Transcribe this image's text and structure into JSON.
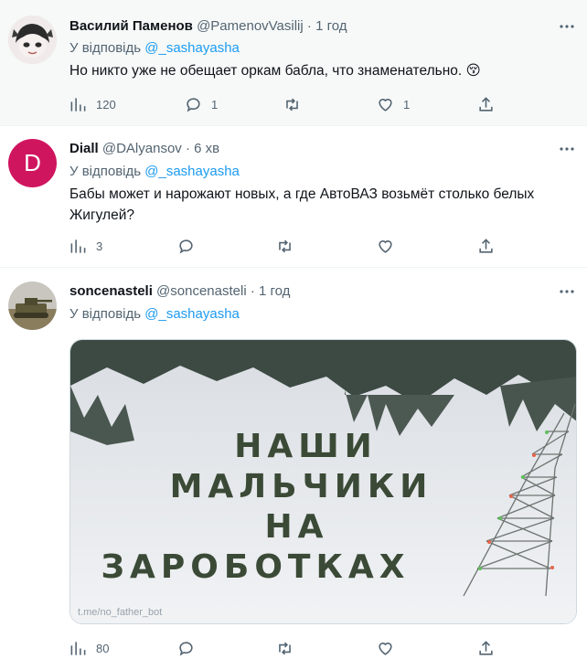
{
  "tweets": [
    {
      "name": "Василий Паменов",
      "handle": "@PamenovVasilij",
      "sep": "·",
      "time": "1 год",
      "reply_prefix": "У відповідь",
      "reply_to": "@_sashayasha",
      "text": "Но никто уже не обещает оркам бабла, что знаменательно. 😚",
      "counts": {
        "views": "120",
        "replies": "1",
        "retweets": "",
        "likes": "1"
      }
    },
    {
      "name": "Diall",
      "handle": "@DAlyansov",
      "sep": "·",
      "time": "6 хв",
      "avatar_letter": "D",
      "reply_prefix": "У відповідь",
      "reply_to": "@_sashayasha",
      "text": "Бабы может и нарожают новых, а где АвтоВАЗ возьмёт столько белых Жигулей?",
      "counts": {
        "views": "3",
        "replies": "",
        "retweets": "",
        "likes": ""
      }
    },
    {
      "name": "soncenasteli",
      "handle": "@soncenasteli",
      "sep": "·",
      "time": "1 год",
      "reply_prefix": "У відповідь",
      "reply_to": "@_sashayasha",
      "image_text": [
        "НАШИ",
        "МАЛЬЧИКИ",
        "НА",
        "ЗАРОБОТКАХ"
      ],
      "watermark": "t.me/no_father_bot",
      "counts": {
        "views": "80"
      }
    }
  ],
  "colors": {
    "accent": "#1d9bf0",
    "muted": "#536471",
    "avatar_d": "#d0155f",
    "hover_bg": "#f7f9f9"
  }
}
